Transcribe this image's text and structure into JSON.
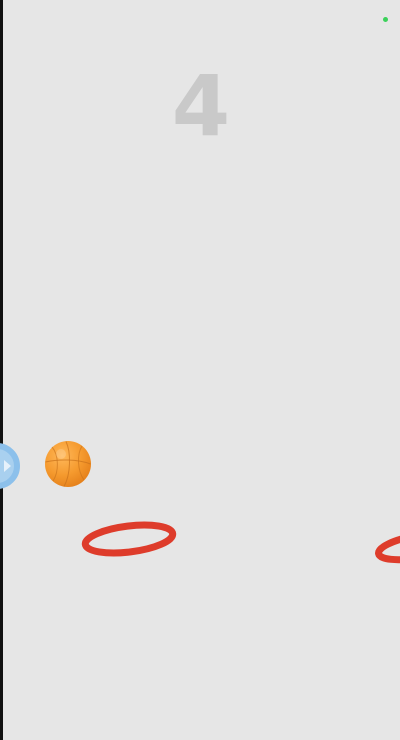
{
  "game": {
    "score": "4"
  },
  "colors": {
    "background": "#e6e6e6",
    "score_text": "#c9c9c9",
    "ball_orange": "#f59a2e",
    "hoop_red": "#de3c2b",
    "offscreen_indicator_blue": "#8cc0eb",
    "status_green": "#3bd15a"
  },
  "icons": {
    "ball": "basketball-icon",
    "hoop": "hoop-ring-icon",
    "offscreen": "offscreen-ball-indicator-icon"
  }
}
